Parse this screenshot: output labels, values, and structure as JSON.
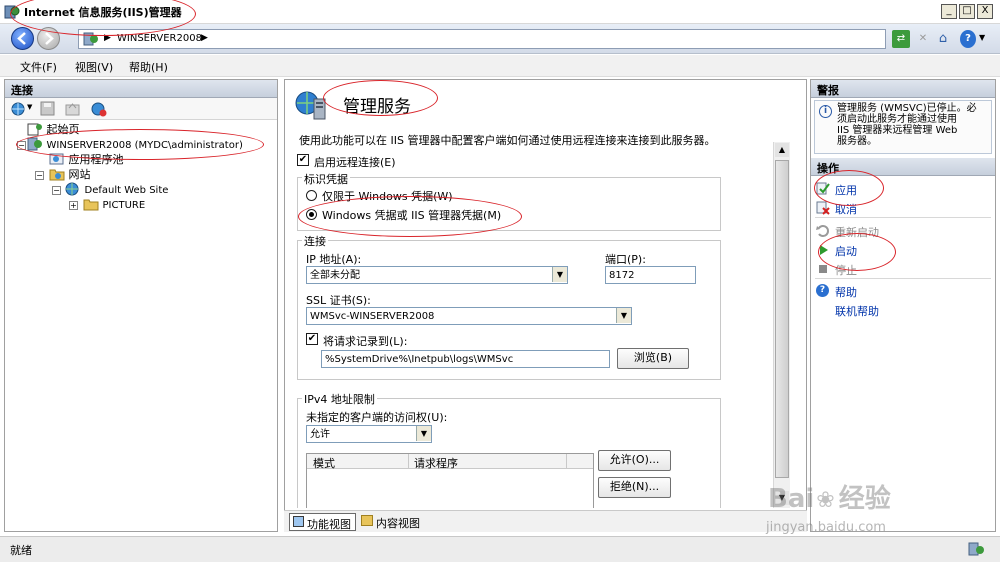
{
  "window": {
    "title": "Internet 信息服务(IIS)管理器",
    "buttons": {
      "minimize": "_",
      "maximize": "□",
      "close": "X"
    }
  },
  "nav": {
    "address_crumb": "WINSERVER2008",
    "help_label": "?"
  },
  "menu": {
    "file": "文件(F)",
    "view": "视图(V)",
    "help": "帮助(H)"
  },
  "connections": {
    "header": "连接",
    "tree": {
      "start_page": "起始页",
      "server": "WINSERVER2008 (MYDC\\administrator)",
      "app_pools": "应用程序池",
      "sites": "网站",
      "default_site": "Default Web Site",
      "picture": "PICTURE"
    }
  },
  "main": {
    "title": "管理服务",
    "description": "使用此功能可以在 IIS 管理器中配置客户端如何通过使用远程连接来连接到此服务器。",
    "enable_remote": {
      "label": "启用远程连接(E)",
      "checked": true
    },
    "identity": {
      "group_title": "标识凭据",
      "option_windows_only": "仅限于 Windows 凭据(W)",
      "option_windows_or_iis": "Windows 凭据或 IIS 管理器凭据(M)",
      "selected": "option_windows_or_iis"
    },
    "connection": {
      "group_title": "连接",
      "ip_label": "IP 地址(A):",
      "ip_value": "全部未分配",
      "port_label": "端口(P):",
      "port_value": "8172",
      "ssl_label": "SSL 证书(S):",
      "ssl_value": "WMSvc-WINSERVER2008",
      "log_label": "将请求记录到(L):",
      "log_checked": true,
      "log_path": "%SystemDrive%\\Inetpub\\logs\\WMSvc",
      "browse_label": "浏览(B)"
    },
    "ipv4": {
      "group_title": "IPv4 地址限制",
      "access_label": "未指定的客户端的访问权(U):",
      "access_value": "允许",
      "columns": [
        "模式",
        "请求程序"
      ],
      "allow_button": "允许(O)...",
      "deny_button": "拒绝(N)..."
    },
    "view_tabs": {
      "feature_view": "功能视图",
      "content_view": "内容视图"
    }
  },
  "actions": {
    "alerts_header": "警报",
    "alert_text": [
      "管理服务 (WMSVC)已停止。必",
      "须启动此服务才能通过使用",
      "IIS 管理器来远程管理 Web",
      "服务器。"
    ],
    "actions_header": "操作",
    "apply": "应用",
    "cancel": "取消",
    "restart": "重新启动",
    "start": "启动",
    "stop": "停止",
    "help": "帮助",
    "online_help": "联机帮助"
  },
  "status": {
    "text": "就绪"
  },
  "watermark": {
    "brand": "Bai",
    "brand_cn": "经验",
    "url": "jingyan.baidu.com"
  },
  "colors": {
    "annotation": "#d9252b",
    "link": "#0033aa"
  }
}
